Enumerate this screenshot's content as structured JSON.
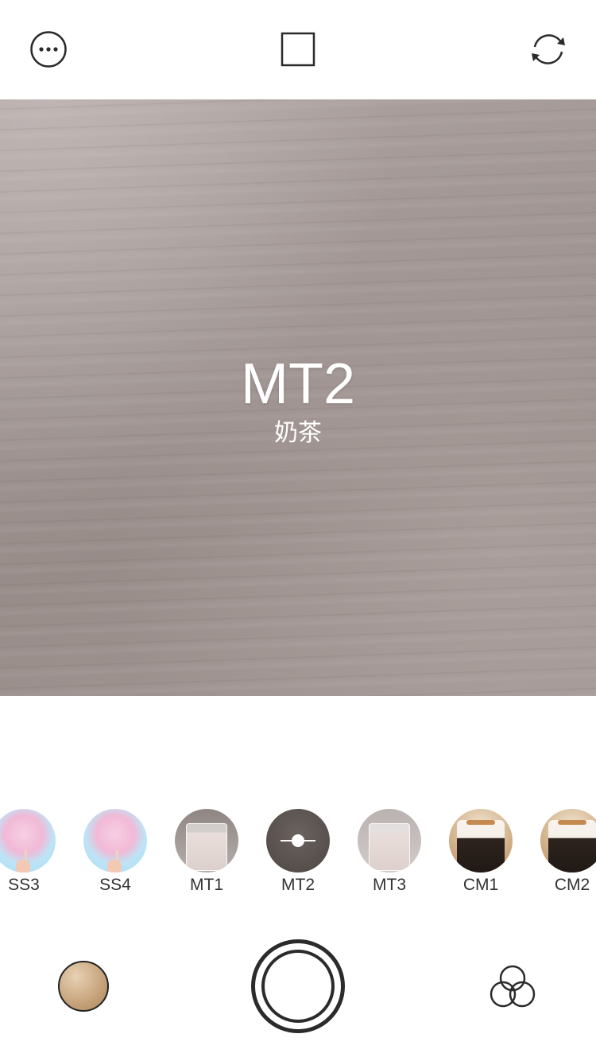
{
  "topbar": {
    "more_icon": "more-ellipsis-icon",
    "aspect_icon": "square-aspect-icon",
    "flip_icon": "camera-flip-icon"
  },
  "viewfinder": {
    "filter_code": "MT2",
    "filter_name_cn": "奶茶"
  },
  "filters": [
    {
      "code": "SS3",
      "thumb": "cotton-candy"
    },
    {
      "code": "SS4",
      "thumb": "cotton-candy"
    },
    {
      "code": "MT1",
      "thumb": "milk-glass"
    },
    {
      "code": "MT2",
      "thumb": "adjust-slider",
      "selected": true
    },
    {
      "code": "MT3",
      "thumb": "milk-glass"
    },
    {
      "code": "CM1",
      "thumb": "coffee-cup"
    },
    {
      "code": "CM2",
      "thumb": "coffee-cup"
    }
  ],
  "bottombar": {
    "gallery_icon": "gallery-thumbnail",
    "shutter_icon": "shutter-button",
    "filters_icon": "filters-circles-icon"
  },
  "colors": {
    "icon": "#2b2b2b",
    "background": "#ffffff"
  }
}
